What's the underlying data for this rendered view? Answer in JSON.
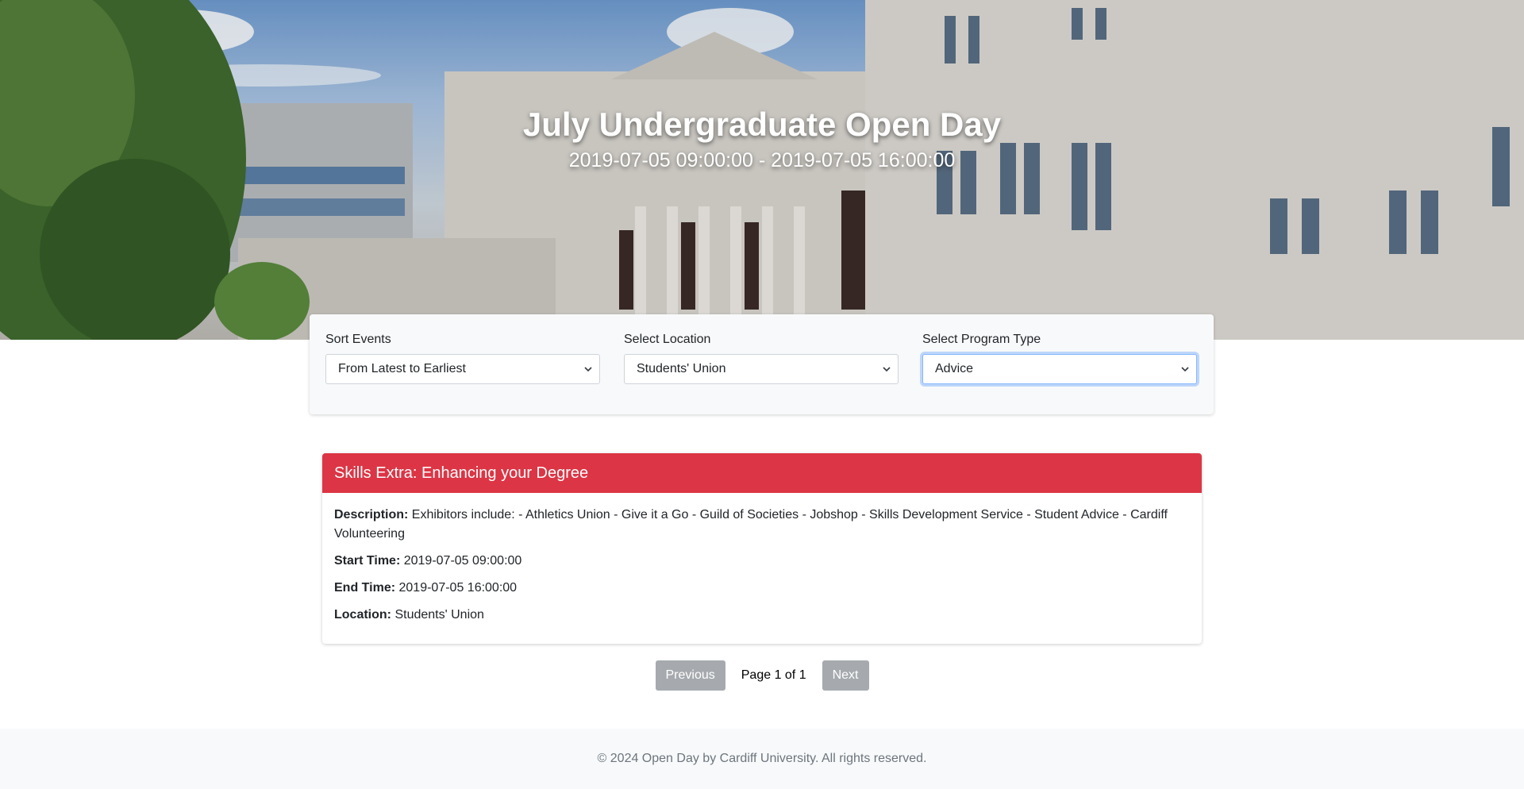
{
  "hero": {
    "title": "July Undergraduate Open Day",
    "dates": "2019-07-05 09:00:00 - 2019-07-05 16:00:00"
  },
  "filters": {
    "sort": {
      "label": "Sort Events",
      "value": "From Latest to Earliest"
    },
    "location": {
      "label": "Select Location",
      "value": "Students' Union"
    },
    "program": {
      "label": "Select Program Type",
      "value": "Advice"
    }
  },
  "event": {
    "title": "Skills Extra: Enhancing your Degree",
    "description_label": "Description:",
    "description": "Exhibitors include: - Athletics Union - Give it a Go - Guild of Societies - Jobshop - Skills Development Service - Student Advice - Cardiff Volunteering",
    "start_label": "Start Time:",
    "start": "2019-07-05 09:00:00",
    "end_label": "End Time:",
    "end": "2019-07-05 16:00:00",
    "location_label": "Location:",
    "location": "Students' Union"
  },
  "pagination": {
    "previous_label": "Previous",
    "info": "Page 1 of 1",
    "next_label": "Next"
  },
  "footer": {
    "text": "© 2024 Open Day by Cardiff University. All rights reserved."
  },
  "colors": {
    "card_header": "#dc3545",
    "pager_button": "#a6aaae",
    "footer_bg": "#f8f9fa"
  },
  "icons": {
    "select_arrow": "chevron-down-icon"
  }
}
